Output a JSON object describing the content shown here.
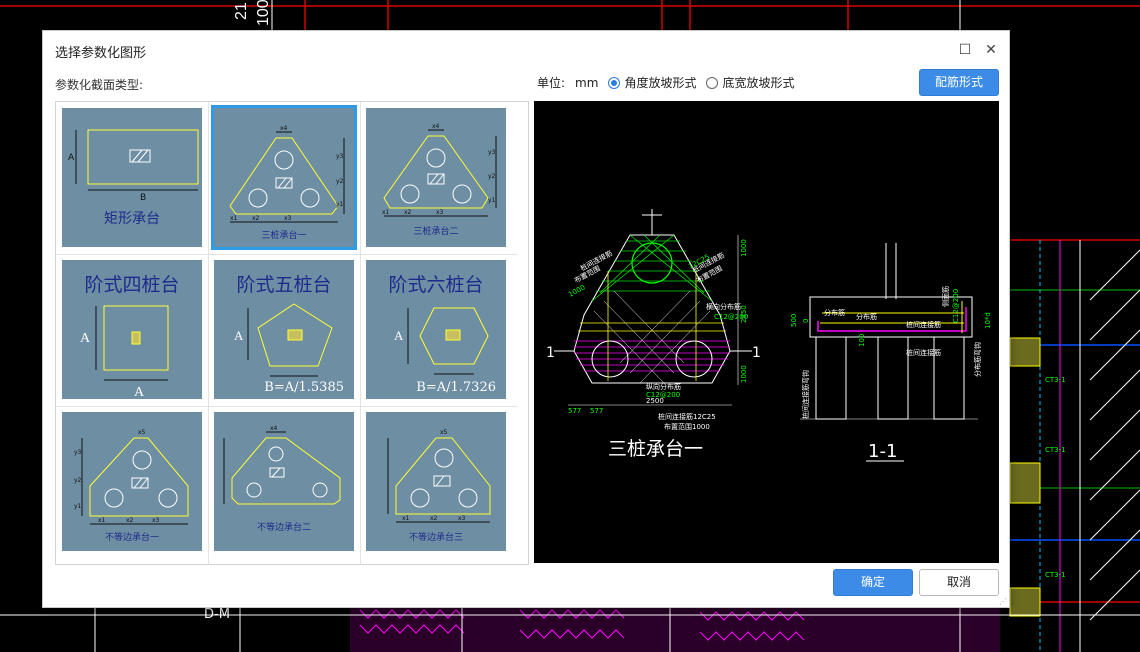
{
  "dialog": {
    "title": "选择参数化图形",
    "section_label": "参数化截面类型:",
    "unit_label": "单位:",
    "unit_value": "mm",
    "radio_options": [
      {
        "label": "角度放坡形式",
        "selected": true
      },
      {
        "label": "底宽放坡形式",
        "selected": false
      }
    ],
    "rebar_button": "配筋形式",
    "ok_button": "确定",
    "cancel_button": "取消",
    "accent_color": "#3c8ce7"
  },
  "thumbnails": [
    {
      "label": "矩形承台"
    },
    {
      "label": "三桩承台一",
      "selected": true
    },
    {
      "label": "三桩承台二"
    },
    {
      "label": "阶式四桩台"
    },
    {
      "label": "阶式五桩台",
      "formula": "B=A/1.5385"
    },
    {
      "label": "阶式六桩台",
      "formula": "B=A/1.7326"
    },
    {
      "label": "不等边承台一"
    },
    {
      "label": "不等边承台二"
    },
    {
      "label": "不等边承台三"
    }
  ],
  "thumb_dims": {
    "A": "A",
    "B": "B",
    "x1": "x1",
    "x2": "x2",
    "x3": "x3",
    "x4": "x4",
    "x5": "x5",
    "y1": "y1",
    "y2": "y2",
    "y3": "y3"
  },
  "preview": {
    "plan_title": "三桩承台一",
    "section_title": "1-1",
    "section_mark": "1",
    "labels": {
      "pile_rebar_left": "桩间连接筋",
      "pile_rebar_right": "桩间连接筋",
      "range_left": "布置范围",
      "range_right": "布置范围",
      "range_left_value": "1000",
      "range_right_value": "1000",
      "dist_bar": "横向分布筋",
      "dist_bar_spec": "C12@200",
      "long_dist": "纵向分布筋",
      "long_spec": "C12@200",
      "bottom_rebar": "桩间连接筋12C25",
      "bottom_range": "布置范围1000",
      "dim_2500": "2500",
      "dim_577": "577",
      "dim_577b": "577",
      "dim_1000": "1000",
      "dim_2850": "2850",
      "dim_1000b": "1000",
      "dim_c25": "12C25",
      "sec_dist1": "分布筋",
      "sec_dist2": "分布筋",
      "sec_side": "侧面筋",
      "sec_pile": "桩间连接筋",
      "sec_pile2": "桩间连接筋",
      "sec_500": "500",
      "sec_vert_left": "桩间连接筋弯钩",
      "sec_vert_right": "分布筋弯钩",
      "sec_10d": "10*d",
      "sec_0": "0",
      "sec_100": "100",
      "sec_spec": "C12@200"
    }
  },
  "cad_bg": {
    "top_text": "21",
    "top_text2": "100",
    "bottom_text": "D-M",
    "tag1": "CT3-1",
    "tag2": "CT3-1",
    "tag3": "CT3-1"
  }
}
